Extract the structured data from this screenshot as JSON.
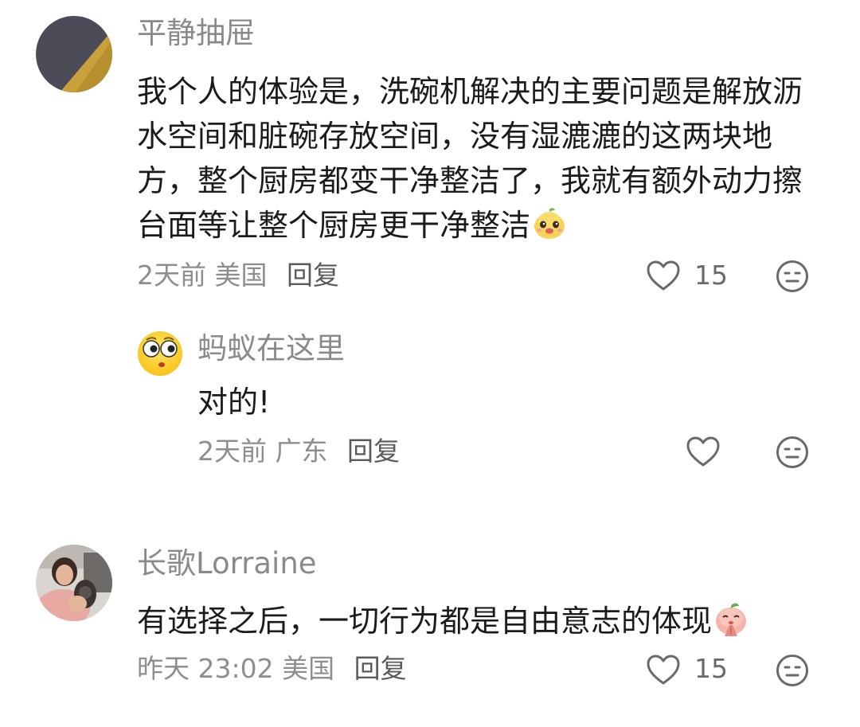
{
  "comments": [
    {
      "username": "平静抽屉",
      "text": "我个人的体验是，洗碗机解决的主要问题是解放沥水空间和脏碗存放空间，没有湿漉漉的这两块地方，整个厨房都变干净整洁了，我就有额外动力擦台面等让整个厨房更干净整洁",
      "text_emoji": "pear-face-emoji",
      "time": "2天前",
      "location": "美国",
      "reply_label": "回复",
      "like_count": "15",
      "avatar": "avatar-black-gold",
      "reply": {
        "username": "蚂蚁在这里",
        "text": "对的!",
        "time": "2天前",
        "location": "广东",
        "reply_label": "回复",
        "avatar": "surprised-face-emoji"
      }
    },
    {
      "username": "长歌Lorraine",
      "text": "有选择之后，一切行为都是自由意志的体现",
      "text_emoji": "peach-pray-emoji",
      "time": "昨天 23:02",
      "location": "美国",
      "reply_label": "回复",
      "like_count": "15",
      "avatar": "avatar-photo"
    }
  ],
  "icons": {
    "like": "heart-outline-icon",
    "dislike": "meh-face-icon"
  },
  "colors": {
    "text": "#1b1b1b",
    "muted": "#8e8e8e",
    "icon": "#6a6a6a"
  }
}
